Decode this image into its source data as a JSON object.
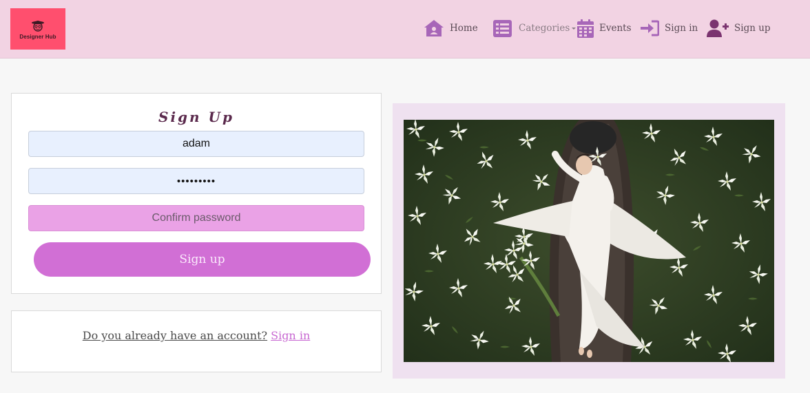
{
  "brand": {
    "logo_text": "Designer Hub",
    "logo_color": "#ff4f6e"
  },
  "nav": {
    "items": [
      {
        "label": "Home",
        "icon": "home-icon"
      },
      {
        "label": "Categories",
        "icon": "list-icon"
      },
      {
        "label": "Events",
        "icon": "calendar-icon"
      },
      {
        "label": "Sign in",
        "icon": "sign-in-icon"
      },
      {
        "label": "Sign up",
        "icon": "user-plus-icon"
      }
    ]
  },
  "signup": {
    "title": "Sign Up",
    "username_value": "adam",
    "password_value": "•••••••••",
    "confirm_placeholder": "Confirm password",
    "submit_label": "Sign up"
  },
  "account_prompt": {
    "question": "Do you already have an account?",
    "link_label": "Sign in"
  },
  "colors": {
    "navbar_bg": "#f2d3e3",
    "accent": "#d16fd5",
    "icon": "#a766b8"
  }
}
